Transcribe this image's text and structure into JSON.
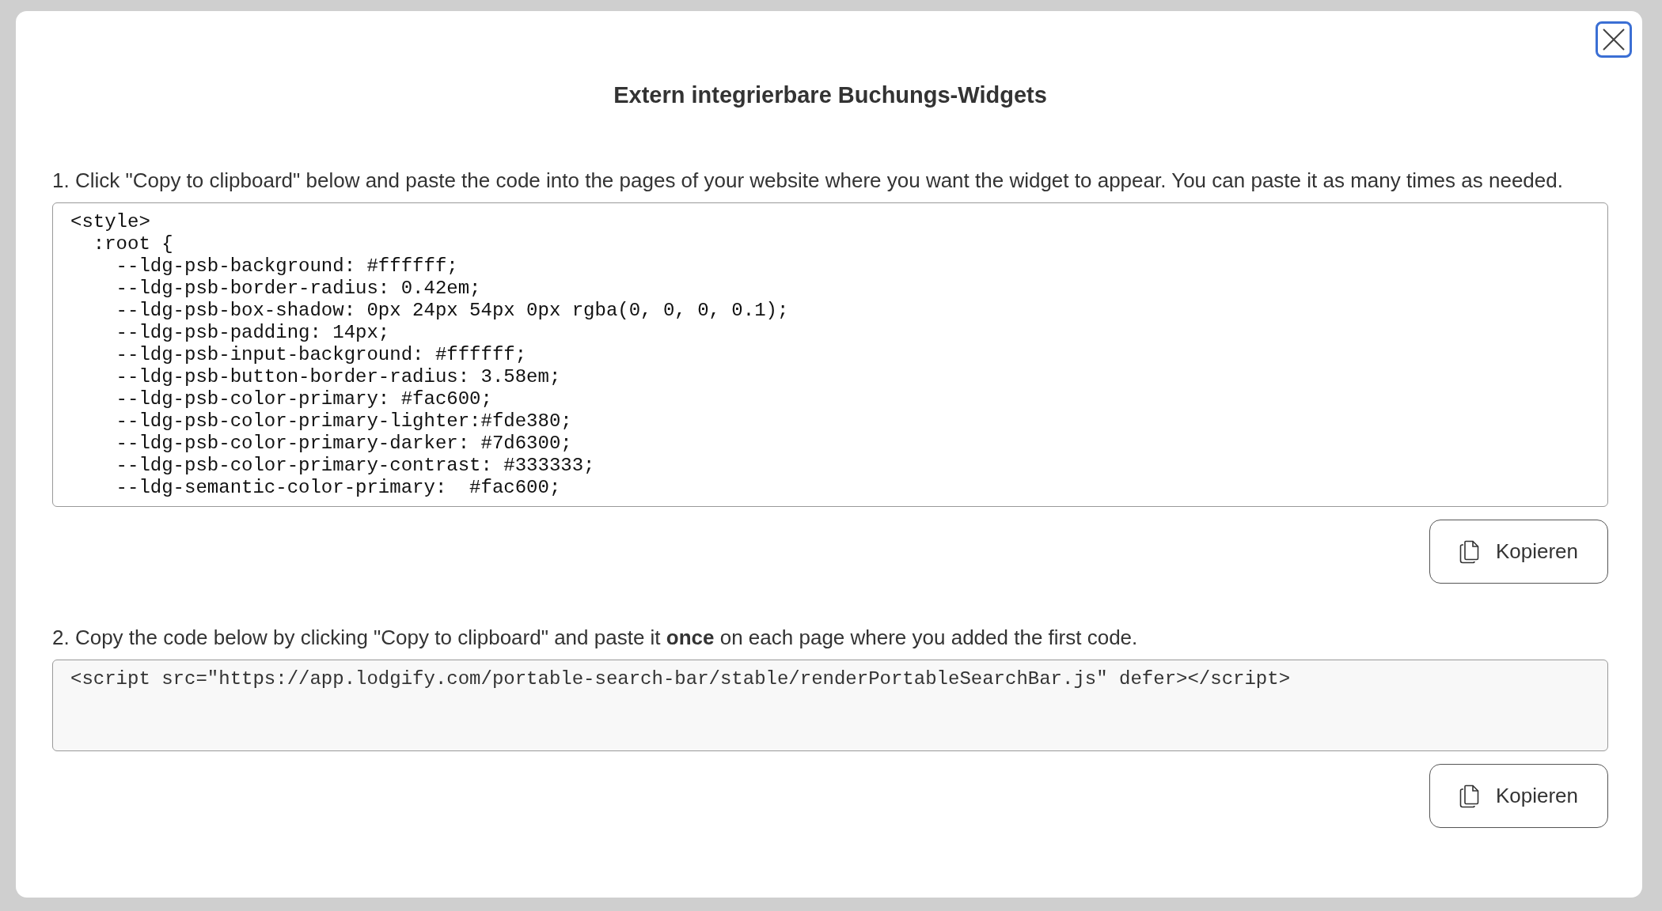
{
  "dialog": {
    "title": "Extern integrierbare Buchungs-Widgets"
  },
  "steps": [
    {
      "number": "1.",
      "instruction": "Click \"Copy to clipboard\" below and paste the code into the pages of your website where you want the widget to appear. You can paste it as many times as needed.",
      "code_lines": [
        "<style>",
        "  :root {",
        "    --ldg-psb-background: #ffffff;",
        "    --ldg-psb-border-radius: 0.42em;",
        "    --ldg-psb-box-shadow: 0px 24px 54px 0px rgba(0, 0, 0, 0.1);",
        "    --ldg-psb-padding: 14px;",
        "    --ldg-psb-input-background: #ffffff;",
        "    --ldg-psb-button-border-radius: 3.58em;",
        "    --ldg-psb-color-primary: #fac600;",
        "    --ldg-psb-color-primary-lighter:#fde380;",
        "    --ldg-psb-color-primary-darker: #7d6300;",
        "    --ldg-psb-color-primary-contrast: #333333;",
        "    --ldg-semantic-color-primary:  #fac600;"
      ],
      "readonly": false,
      "button": "Kopieren"
    },
    {
      "number": "2.",
      "instruction": "Copy the code below by clicking \"Copy to clipboard\" and paste it **once** on each page where you added the first code.",
      "code_lines": [
        "<script src=\"https://app.lodgify.com/portable-search-bar/stable/renderPortableSearchBar.js\" defer></script>"
      ],
      "readonly": true,
      "button": "Kopieren"
    }
  ]
}
